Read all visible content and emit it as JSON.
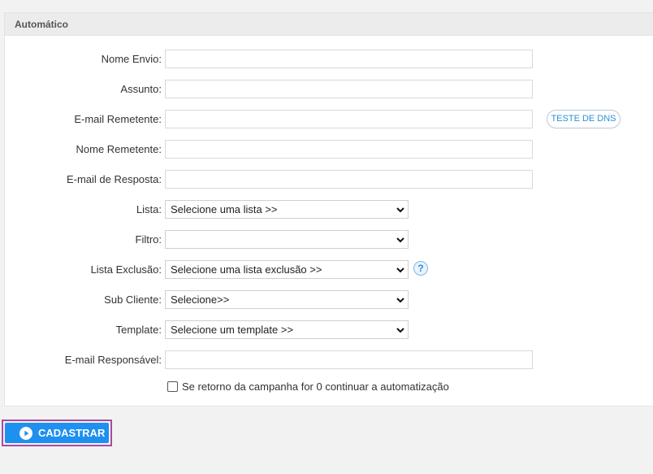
{
  "panel": {
    "title": "Automático"
  },
  "fields": {
    "nome_envio": {
      "label": "Nome Envio:",
      "value": ""
    },
    "assunto": {
      "label": "Assunto:",
      "value": ""
    },
    "email_remetente": {
      "label": "E-mail Remetente:",
      "value": ""
    },
    "nome_remetente": {
      "label": "Nome Remetente:",
      "value": ""
    },
    "email_resposta": {
      "label": "E-mail de Resposta:",
      "value": ""
    },
    "lista": {
      "label": "Lista:",
      "selected": "Selecione uma lista >>"
    },
    "filtro": {
      "label": "Filtro:",
      "selected": ""
    },
    "lista_exclusao": {
      "label": "Lista Exclusão:",
      "selected": "Selecione uma lista exclusão >>"
    },
    "sub_cliente": {
      "label": "Sub Cliente:",
      "selected": "Selecione>>"
    },
    "template": {
      "label": "Template:",
      "selected": "Selecione um template >>"
    },
    "email_responsavel": {
      "label": "E-mail Responsável:",
      "value": ""
    }
  },
  "dns_button": {
    "label": "TESTE DE DNS"
  },
  "help_icon": {
    "glyph": "?"
  },
  "checkbox": {
    "label": "Se retorno da campanha for 0 continuar a automatização",
    "checked": false
  },
  "submit": {
    "label": "CADASTRAR"
  },
  "colors": {
    "accent": "#1e90f0",
    "highlight_border": "#a94aa3",
    "link": "#2a93d5"
  }
}
